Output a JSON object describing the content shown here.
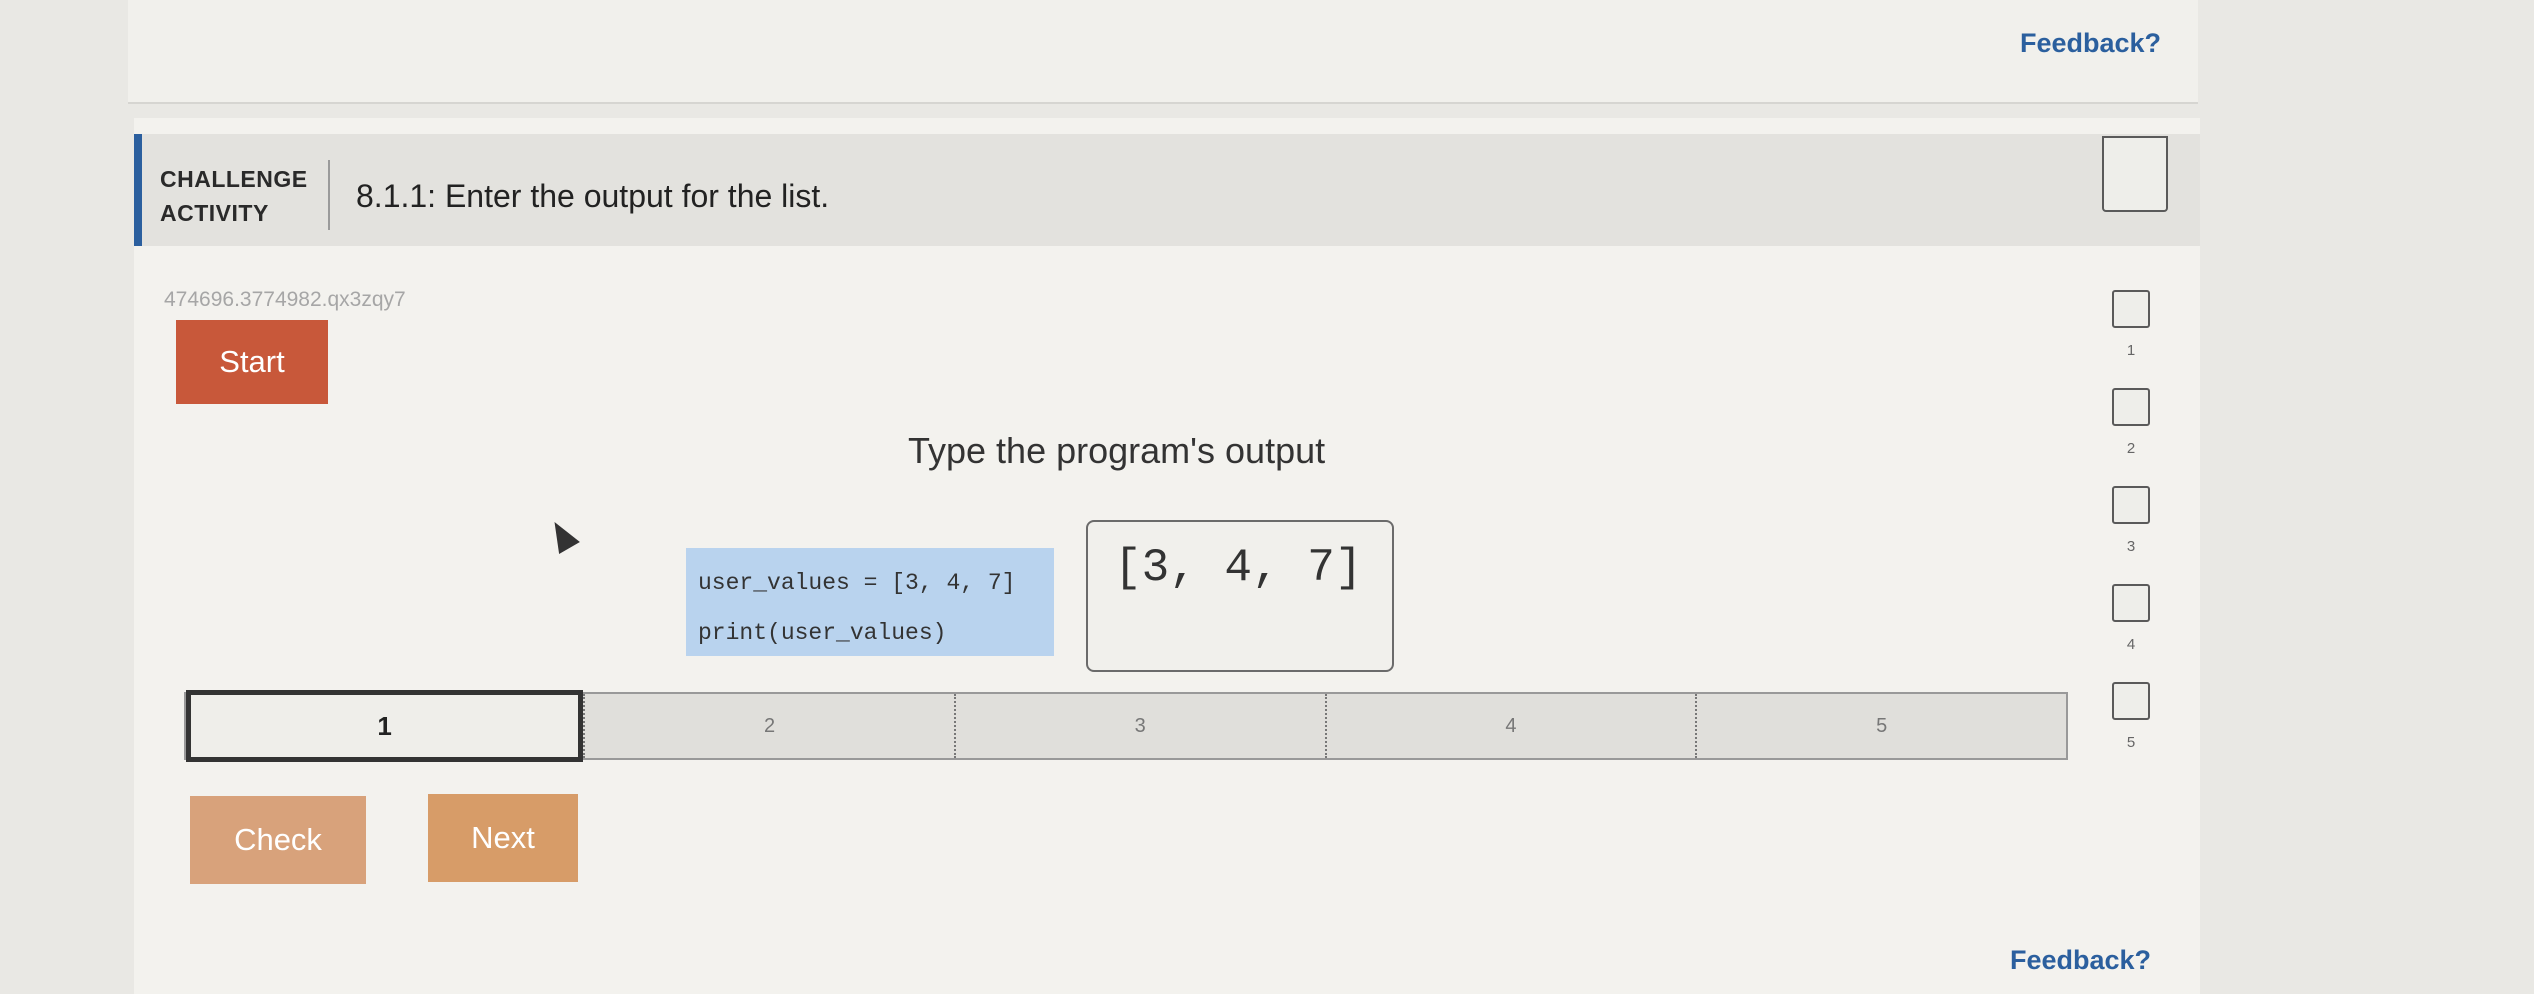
{
  "feedback": {
    "top": "Feedback?",
    "bottom": "Feedback?"
  },
  "challenge": {
    "label_line1": "CHALLENGE",
    "label_line2": "ACTIVITY",
    "title": "8.1.1: Enter the output for the list.",
    "activity_id": "474696.3774982.qx3zqy7"
  },
  "start_label": "Start",
  "prompt": "Type the program's output",
  "code": {
    "line1": "user_values = [3, 4, 7]",
    "line2": "print(user_values)"
  },
  "answer": "[3, 4, 7]",
  "progress": {
    "steps": [
      "1",
      "2",
      "3",
      "4",
      "5"
    ],
    "active_step": 1
  },
  "buttons": {
    "check": "Check",
    "next": "Next"
  },
  "levels": [
    "1",
    "2",
    "3",
    "4",
    "5"
  ],
  "colors": {
    "accent": "#2b5f9e",
    "start": "#c8583a",
    "check": "#d8a27b",
    "next": "#d79c68",
    "code_bg": "#b9d3ee"
  }
}
